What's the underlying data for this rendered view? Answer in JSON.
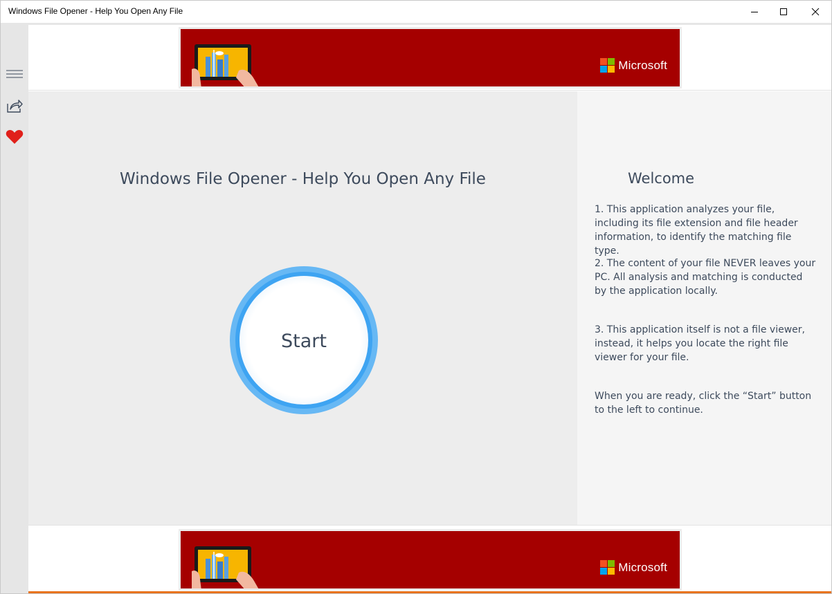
{
  "window": {
    "title": "Windows File Opener - Help You Open Any File",
    "controls": [
      "minimize-icon",
      "maximize-icon",
      "close-icon"
    ]
  },
  "rail": {
    "items": [
      {
        "name": "menu",
        "icon": "hamburger-icon"
      },
      {
        "name": "share",
        "icon": "share-icon"
      },
      {
        "name": "favorite",
        "icon": "heart-icon",
        "color": "#e0201b"
      }
    ]
  },
  "banner": {
    "brand": "Microsoft",
    "background": "#a50000",
    "logo_colors": [
      "#f25022",
      "#7fba00",
      "#00a4ef",
      "#ffb900"
    ]
  },
  "main": {
    "title": "Windows File Opener - Help You Open Any File",
    "start_label": "Start"
  },
  "welcome": {
    "title": "Welcome",
    "paragraphs": [
      "1. This application analyzes your file, including its file extension and file header information, to identify the matching file type.",
      "2. The content of your file NEVER leaves your PC. All analysis and matching is conducted by the application locally.",
      "3. This application itself is not a file viewer, instead, it helps you locate the right file viewer for your file.",
      "When you are ready, click the “Start” button to the left to continue."
    ]
  },
  "colors": {
    "text": "#3d4a5c",
    "accent_blue": "#3ea4f2",
    "bottom_accent": "#e8731d"
  }
}
